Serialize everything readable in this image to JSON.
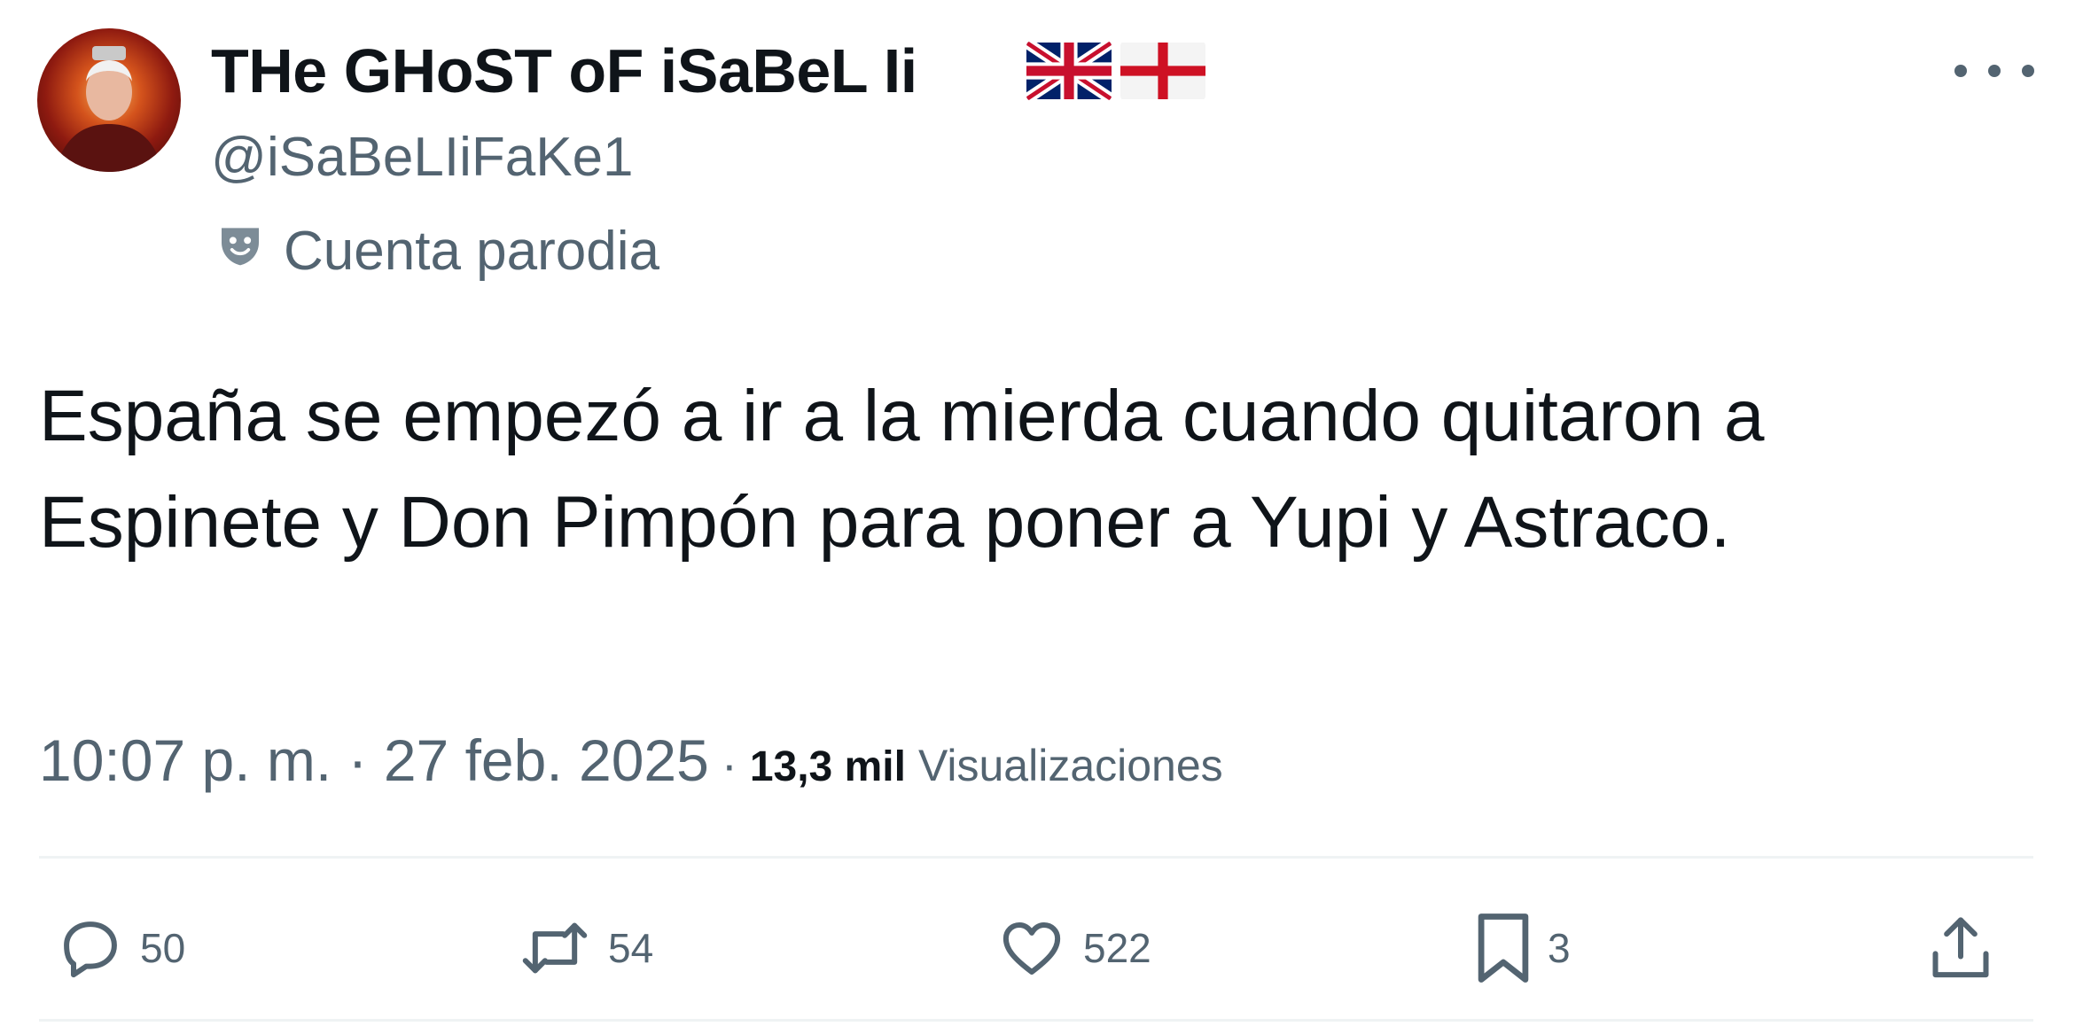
{
  "author": {
    "display_name": "THe GHoST oF iSaBeL Ii",
    "handle": "@iSaBeLIiFaKe1",
    "parody_label": "Cuenta parodia",
    "flags": [
      "united-kingdom-flag",
      "england-flag"
    ]
  },
  "tweet": {
    "text": "España se empezó a ir a la mierda cuando quitaron a Espinete y Don Pimpón para poner a Yupi y Astraco.",
    "timestamp": "10:07 p. m. · 27 feb. 2025",
    "separator": "·",
    "views_count": "13,3 mil",
    "views_label": "Visualizaciones"
  },
  "actions": {
    "replies": "50",
    "reposts": "54",
    "likes": "522",
    "bookmarks": "3"
  },
  "icons": [
    "more-icon",
    "reply-icon",
    "repost-icon",
    "like-icon",
    "bookmark-icon",
    "share-icon",
    "parody-mask-icon"
  ],
  "colors": {
    "text_primary": "#0f1419",
    "text_secondary": "#536471",
    "divider": "#eff3f4"
  }
}
